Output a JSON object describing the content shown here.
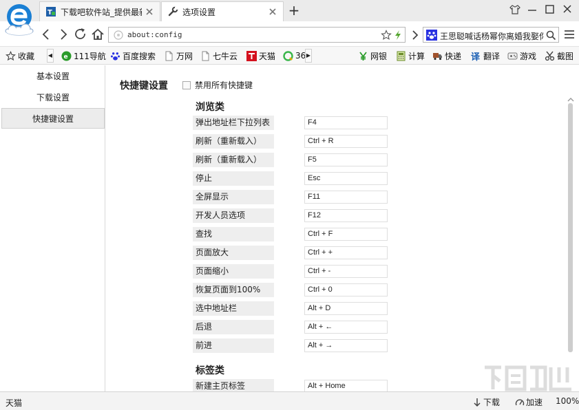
{
  "tabs": [
    {
      "title": "下载吧软件站_提供最新",
      "icon": "site-favicon"
    },
    {
      "title": "选项设置",
      "icon": "wrench-icon"
    }
  ],
  "address": {
    "url": "about:config"
  },
  "search": {
    "text": "王思聪喊话杨幂你离婚我娶你"
  },
  "bookmarks": {
    "left": [
      {
        "label": "收藏",
        "icon": "star-icon"
      },
      {
        "label": "111导航",
        "icon": "nav-e-icon"
      },
      {
        "label": "百度搜索",
        "icon": "baidu-paw-icon"
      },
      {
        "label": "万网",
        "icon": "page-icon"
      },
      {
        "label": "七牛云",
        "icon": "page-icon"
      },
      {
        "label": "天猫",
        "icon": "tmall-icon"
      },
      {
        "label": "36",
        "icon": "360-icon"
      }
    ],
    "right": [
      {
        "label": "网银",
        "icon": "yen-icon"
      },
      {
        "label": "计算",
        "icon": "calculator-icon"
      },
      {
        "label": "快递",
        "icon": "truck-icon"
      },
      {
        "label": "翻译",
        "icon": "translate-icon"
      },
      {
        "label": "游戏",
        "icon": "gamepad-icon"
      },
      {
        "label": "截图",
        "icon": "scissors-icon"
      }
    ]
  },
  "sidebar": {
    "items": [
      {
        "label": "基本设置"
      },
      {
        "label": "下载设置"
      },
      {
        "label": "快捷键设置",
        "active": true
      }
    ]
  },
  "main": {
    "title": "快捷键设置",
    "disable_all_label": "禁用所有快捷键",
    "sections": [
      {
        "title": "浏览类",
        "rows": [
          {
            "label": "弹出地址栏下拉列表",
            "key": "F4"
          },
          {
            "label": "刷新（重新载入）",
            "key": "Ctrl + R"
          },
          {
            "label": "刷新（重新载入）",
            "key": "F5"
          },
          {
            "label": "停止",
            "key": "Esc"
          },
          {
            "label": "全屏显示",
            "key": "F11"
          },
          {
            "label": "开发人员选项",
            "key": "F12"
          },
          {
            "label": "查找",
            "key": "Ctrl + F"
          },
          {
            "label": "页面放大",
            "key": "Ctrl + +"
          },
          {
            "label": "页面缩小",
            "key": "Ctrl + -"
          },
          {
            "label": "恢复页面到100%",
            "key": "Ctrl + 0"
          },
          {
            "label": "选中地址栏",
            "key": "Alt + D"
          },
          {
            "label": "后退",
            "key": "Alt + ←"
          },
          {
            "label": "前进",
            "key": "Alt + →"
          }
        ]
      },
      {
        "title": "标签类",
        "rows": [
          {
            "label": "新建主页标签",
            "key": "Alt + Home"
          }
        ]
      }
    ]
  },
  "status": {
    "text": "天猫",
    "download_label": "下载",
    "speedup_label": "加速",
    "zoom": "100%"
  },
  "colors": {
    "accent": "#1a7fd4",
    "tmall": "#d4111e",
    "nav_green": "#2a9b2a"
  }
}
